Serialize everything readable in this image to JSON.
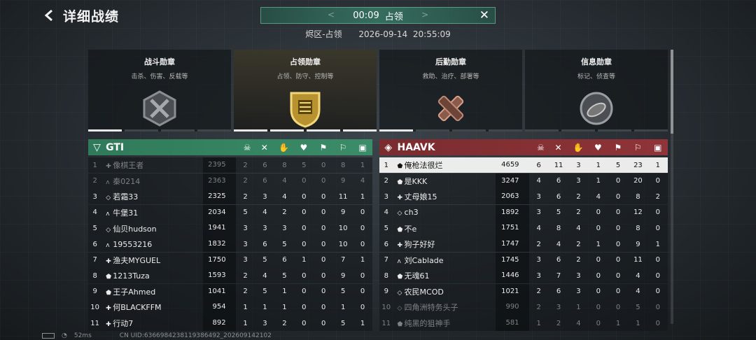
{
  "header": {
    "title": "详细战绩",
    "timer": "00:09",
    "mode": "占领",
    "map": "烬区-占领",
    "datetime": "2026-09-14 20:55:09"
  },
  "medals": [
    {
      "title": "战斗勋章",
      "subtitle": "击杀、伤害、反载等",
      "icon": "combat-medal-icon",
      "progress": 1
    },
    {
      "title": "占领勋章",
      "subtitle": "占领、防守、控制等",
      "icon": "capture-medal-icon",
      "progress": 4
    },
    {
      "title": "后勤勋章",
      "subtitle": "救助、治疗、部署等",
      "icon": "logistics-medal-icon",
      "progress": 1
    },
    {
      "title": "信息勋章",
      "subtitle": "标记、侦查等",
      "icon": "intel-medal-icon",
      "progress": 0
    }
  ],
  "teams": {
    "left": {
      "name": "GTI",
      "color": "#3b8c68",
      "players": [
        {
          "rank": "1",
          "prefix": "✚",
          "name": "像棋王者",
          "score": "2395",
          "stats": [
            "2",
            "6",
            "8",
            "5",
            "0",
            "8",
            "1"
          ],
          "dim": true
        },
        {
          "rank": "2",
          "prefix": "ʌ",
          "name": "秦0214",
          "score": "2363",
          "stats": [
            "2",
            "6",
            "4",
            "0",
            "0",
            "9",
            "4"
          ],
          "dim": true
        },
        {
          "rank": "3",
          "prefix": "◇",
          "name": "若霜33",
          "score": "2325",
          "stats": [
            "2",
            "3",
            "4",
            "0",
            "0",
            "11",
            "1"
          ]
        },
        {
          "rank": "4",
          "prefix": "ʌ",
          "name": "牛堡31",
          "score": "2034",
          "stats": [
            "5",
            "4",
            "2",
            "0",
            "0",
            "9",
            "0"
          ]
        },
        {
          "rank": "5",
          "prefix": "◇",
          "name": "仙贝hudson",
          "score": "1941",
          "stats": [
            "3",
            "3",
            "3",
            "0",
            "0",
            "10",
            "0"
          ]
        },
        {
          "rank": "6",
          "prefix": "ʌ",
          "name": "19553216",
          "score": "1832",
          "stats": [
            "3",
            "6",
            "5",
            "0",
            "0",
            "10",
            "0"
          ]
        },
        {
          "rank": "7",
          "prefix": "✚",
          "name": "渔夫MYGUEL",
          "score": "1750",
          "stats": [
            "3",
            "5",
            "6",
            "1",
            "0",
            "7",
            "1"
          ]
        },
        {
          "rank": "8",
          "prefix": "⬟",
          "name": "1213Tuza",
          "score": "1593",
          "stats": [
            "2",
            "4",
            "5",
            "0",
            "0",
            "9",
            "0"
          ]
        },
        {
          "rank": "9",
          "prefix": "⬟",
          "name": "王子Ahmed",
          "score": "1041",
          "stats": [
            "2",
            "5",
            "1",
            "0",
            "0",
            "5",
            "0"
          ]
        },
        {
          "rank": "10",
          "prefix": "✚",
          "name": "何BLACKFFM",
          "score": "954",
          "stats": [
            "1",
            "1",
            "1",
            "0",
            "0",
            "1",
            "0"
          ]
        },
        {
          "rank": "11",
          "prefix": "✚",
          "name": "行动7",
          "score": "892",
          "stats": [
            "1",
            "3",
            "2",
            "0",
            "0",
            "5",
            "1"
          ]
        }
      ]
    },
    "right": {
      "name": "HAAVK",
      "color": "#8f3438",
      "players": [
        {
          "rank": "1",
          "prefix": "⬟",
          "name": "俺枪法很烂",
          "score": "4659",
          "stats": [
            "6",
            "11",
            "3",
            "1",
            "5",
            "23",
            "1"
          ],
          "highlight": true
        },
        {
          "rank": "2",
          "prefix": "⬟",
          "name": "是KKK",
          "score": "3247",
          "stats": [
            "4",
            "6",
            "3",
            "1",
            "0",
            "20",
            "0"
          ]
        },
        {
          "rank": "3",
          "prefix": "✚",
          "name": "丈母娘15",
          "score": "2063",
          "stats": [
            "3",
            "6",
            "2",
            "4",
            "0",
            "8",
            "2"
          ]
        },
        {
          "rank": "4",
          "prefix": "◇",
          "name": "ch3",
          "score": "1892",
          "stats": [
            "3",
            "5",
            "2",
            "0",
            "0",
            "12",
            "0"
          ]
        },
        {
          "rank": "5",
          "prefix": "⬟",
          "name": "不e",
          "score": "1751",
          "stats": [
            "4",
            "8",
            "4",
            "0",
            "0",
            "8",
            "0"
          ]
        },
        {
          "rank": "6",
          "prefix": "✚",
          "name": "狗子好好",
          "score": "1747",
          "stats": [
            "2",
            "4",
            "2",
            "1",
            "0",
            "9",
            "1"
          ]
        },
        {
          "rank": "7",
          "prefix": "ʌ",
          "name": "刘Cablade",
          "score": "1745",
          "stats": [
            "3",
            "6",
            "2",
            "0",
            "0",
            "11",
            "0"
          ]
        },
        {
          "rank": "8",
          "prefix": "⬟",
          "name": "无魂61",
          "score": "1446",
          "stats": [
            "3",
            "7",
            "3",
            "0",
            "0",
            "4",
            "0"
          ]
        },
        {
          "rank": "9",
          "prefix": "◇",
          "name": "农民MCOD",
          "score": "1021",
          "stats": [
            "2",
            "6",
            "3",
            "0",
            "0",
            "4",
            "0"
          ]
        },
        {
          "rank": "10",
          "prefix": "◇",
          "name": "四角洲特务头子",
          "score": "990",
          "stats": [
            "2",
            "3",
            "1",
            "0",
            "0",
            "5",
            "0"
          ],
          "dim": true
        },
        {
          "rank": "11",
          "prefix": "⬟",
          "name": "纯黑的狙神手",
          "score": "581",
          "stats": [
            "1",
            "2",
            "4",
            "0",
            "1",
            "1",
            "0"
          ],
          "dim": true
        }
      ]
    }
  },
  "stat_columns": [
    "score-icon",
    "kills-icon",
    "deaths-icon",
    "assists-icon",
    "revive-icon",
    "capture-icon",
    "objective-icon",
    "medkit-icon"
  ],
  "footer": {
    "ping": "52ms",
    "uid": "CN UID:6366984238119386492_202609142102"
  }
}
